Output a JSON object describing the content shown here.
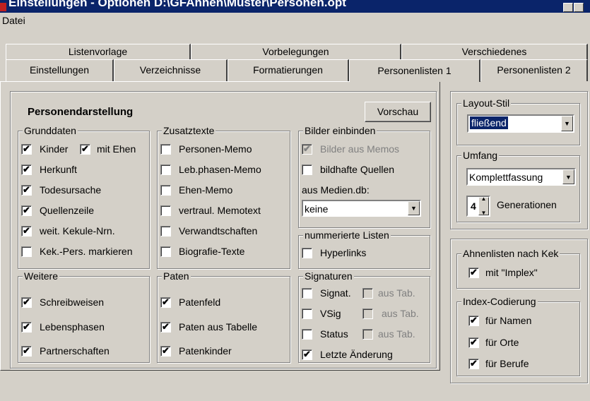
{
  "window": {
    "title": "Einstellungen - Optionen  D:\\GFAhnen\\Muster\\Personen.opt"
  },
  "menu": {
    "datei": "Datei"
  },
  "tabs": {
    "row_top": [
      {
        "label": "Listenvorlage"
      },
      {
        "label": "Vorbelegungen"
      },
      {
        "label": "Verschiedenes"
      }
    ],
    "row_bottom": [
      {
        "label": "Einstellungen"
      },
      {
        "label": "Verzeichnisse"
      },
      {
        "label": "Formatierungen"
      },
      {
        "label": "Personenlisten 1",
        "active": true
      },
      {
        "label": "Personenlisten 2"
      }
    ]
  },
  "panel": {
    "heading": "Personendarstellung",
    "preview_button": "Vorschau",
    "grunddaten": {
      "title": "Grunddaten",
      "kinder": "Kinder",
      "mit_ehen": "mit Ehen",
      "herkunft": "Herkunft",
      "todesursache": "Todesursache",
      "quellenzeile": "Quellenzeile",
      "kekule": "weit. Kekule-Nrn.",
      "kek_pers": "Kek.-Pers. markieren"
    },
    "zusatztexte": {
      "title": "Zusatztexte",
      "items": [
        "Personen-Memo",
        "Leb.phasen-Memo",
        "Ehen-Memo",
        "vertraul. Memotext",
        "Verwandtschaften",
        "Biografie-Texte"
      ]
    },
    "bilder": {
      "title": "Bilder einbinden",
      "bilder_memos": "Bilder aus Memos",
      "bildhafte": "bildhafte Quellen",
      "medien_label": "aus Medien.db:",
      "medien_value": "keine"
    },
    "nummeriert": {
      "title": "nummerierte Listen",
      "hyperlinks": "Hyperlinks"
    },
    "weitere": {
      "title": "Weitere",
      "items": [
        "Schreibweisen",
        "Lebensphasen",
        "Partnerschaften"
      ]
    },
    "paten": {
      "title": "Paten",
      "items": [
        "Patenfeld",
        "Paten aus Tabelle",
        "Patenkinder"
      ]
    },
    "signaturen": {
      "title": "Signaturen",
      "signat": "Signat.",
      "vsig": "VSig",
      "status": "Status",
      "aus_tab": "aus Tab.",
      "letzte": "Letzte Änderung"
    }
  },
  "right": {
    "layout": {
      "title": "Layout-Stil",
      "value": "fließend"
    },
    "umfang": {
      "title": "Umfang",
      "value": "Komplettfassung",
      "generations_value": "4",
      "generations_label": "Generationen"
    },
    "kek": {
      "title": "Ahnenlisten nach Kek",
      "implex": "mit \"Implex\""
    },
    "index": {
      "title": "Index-Codierung",
      "namen": "für Namen",
      "orte": "für Orte",
      "berufe": "für Berufe"
    }
  },
  "icons": {
    "check": "check-icon",
    "dropdown": "chevron-down-icon"
  }
}
